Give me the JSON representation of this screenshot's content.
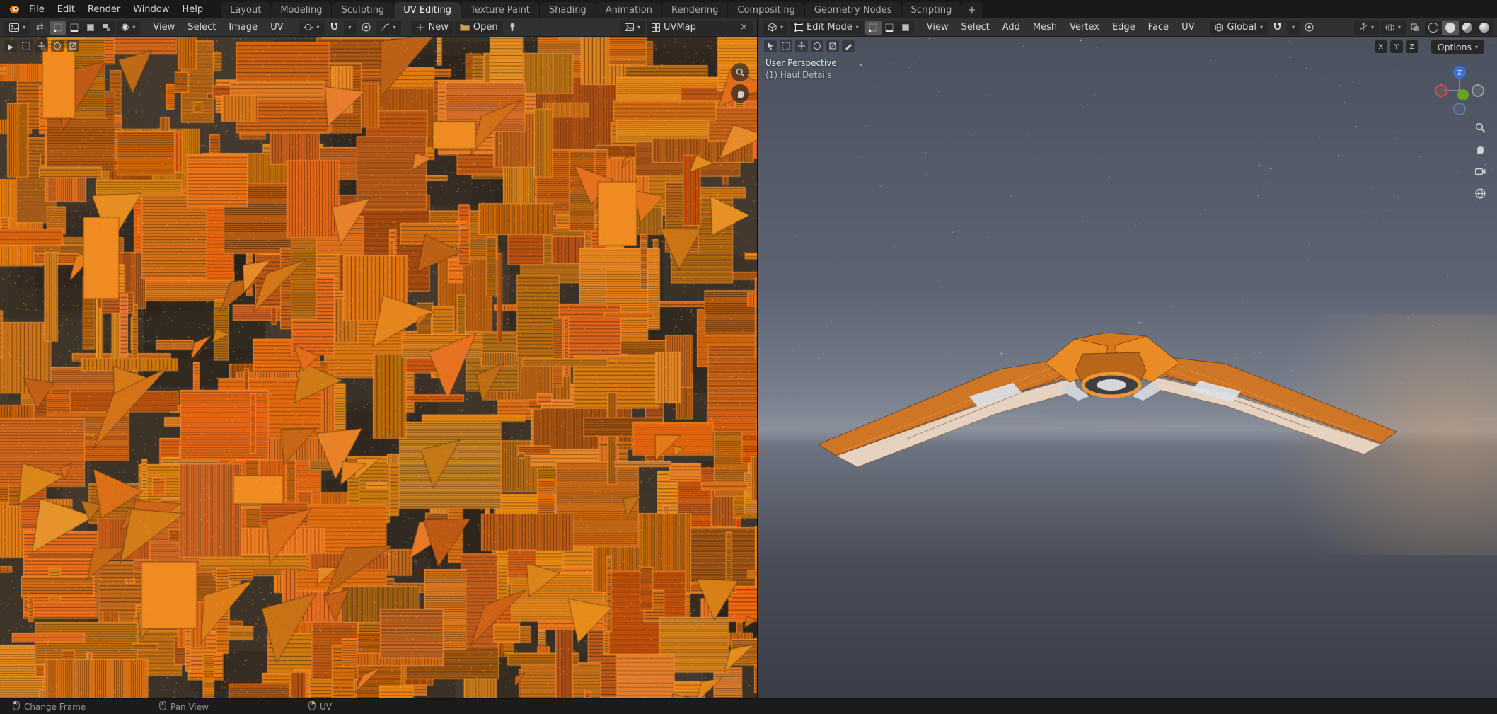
{
  "topbar": {
    "menus": [
      "File",
      "Edit",
      "Render",
      "Window",
      "Help"
    ],
    "tabs": [
      "Layout",
      "Modeling",
      "Sculpting",
      "UV Editing",
      "Texture Paint",
      "Shading",
      "Animation",
      "Rendering",
      "Compositing",
      "Geometry Nodes",
      "Scripting"
    ],
    "active_tab": "UV Editing",
    "add_tab_label": "+"
  },
  "uv_editor": {
    "menus": [
      "View",
      "Select",
      "Image",
      "UV"
    ],
    "new_button_label": "New",
    "open_button_label": "Open",
    "uv_map_name": "UVMap",
    "close_uvmap_label": "×"
  },
  "viewport": {
    "mode_label": "Edit Mode",
    "menus": [
      "View",
      "Select",
      "Add",
      "Mesh",
      "Vertex",
      "Edge",
      "Face",
      "UV"
    ],
    "orientation_label": "Global",
    "options_label": "Options",
    "mirror_toggles": [
      "X",
      "Y",
      "Z"
    ],
    "gizmo": {
      "z_label": "Z"
    },
    "overlay": {
      "line1": "User Perspective",
      "line2": "(1) Haul Details"
    }
  },
  "statusbar": {
    "hints": [
      "Change Frame",
      "Pan View",
      "UV"
    ]
  },
  "colors": {
    "accent_orange": "#f08a28",
    "axis_x_red": "#d14b57",
    "axis_y_green": "#6aa321",
    "axis_z_blue": "#3d6fd9"
  }
}
